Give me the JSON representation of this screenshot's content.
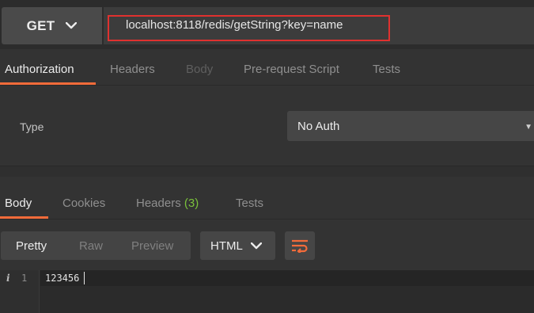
{
  "request": {
    "method": "GET",
    "url": "localhost:8118/redis/getString?key=name"
  },
  "request_tabs": [
    {
      "label": "Authorization",
      "state": "active"
    },
    {
      "label": "Headers",
      "state": "normal"
    },
    {
      "label": "Body",
      "state": "disabled"
    },
    {
      "label": "Pre-request Script",
      "state": "normal"
    },
    {
      "label": "Tests",
      "state": "normal"
    }
  ],
  "auth": {
    "type_label": "Type",
    "selected": "No Auth"
  },
  "response_tabs": [
    {
      "label": "Body",
      "state": "active"
    },
    {
      "label": "Cookies",
      "state": "normal"
    },
    {
      "label": "Headers",
      "count": "(3)",
      "state": "normal"
    },
    {
      "label": "Tests",
      "state": "normal"
    }
  ],
  "response_view": {
    "modes": [
      "Pretty",
      "Raw",
      "Preview"
    ],
    "selected_mode": "Pretty",
    "format": "HTML"
  },
  "response_body": {
    "line_number": "1",
    "info_icon": "i",
    "content": "123456"
  },
  "colors": {
    "accent": "#f26b3a",
    "highlight_box": "#e0312f",
    "count": "#7ac13b"
  }
}
